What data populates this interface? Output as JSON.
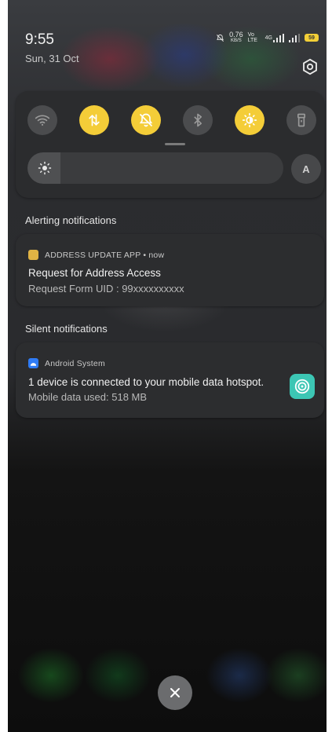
{
  "status_bar": {
    "time": "9:55",
    "date": "Sun, 31 Oct",
    "network_speed": "0.76",
    "network_speed_unit": "KB/S",
    "volte": "Vo LTE",
    "signal_label": "4G",
    "battery_level": "59"
  },
  "quick_settings": {
    "tiles": [
      {
        "name": "wifi",
        "state": "off",
        "icon": "wifi-icon"
      },
      {
        "name": "mobile-data",
        "state": "on",
        "icon": "data-arrows-icon"
      },
      {
        "name": "silent",
        "state": "on",
        "icon": "bell-off-icon"
      },
      {
        "name": "bluetooth",
        "state": "off",
        "icon": "bluetooth-icon"
      },
      {
        "name": "dark-mode",
        "state": "on",
        "icon": "sun-moon-icon"
      },
      {
        "name": "flashlight",
        "state": "off",
        "icon": "flashlight-icon"
      }
    ],
    "brightness_level": 0.13,
    "auto_brightness_label": "A"
  },
  "sections": {
    "alerting_title": "Alerting notifications",
    "silent_title": "Silent notifications"
  },
  "notifications": {
    "address": {
      "app_name": "ADDRESS UPDATE APP",
      "time": "now",
      "title": "Request for Address Access",
      "text": "Request Form UID : 99xxxxxxxxxx"
    },
    "hotspot": {
      "app_name": "Android System",
      "title": "1 device is connected to your mobile data hotspot.",
      "text": "Mobile data used: 518 MB"
    }
  },
  "colors": {
    "toggle_on": "#f4cd38",
    "toggle_off": "#4b4c4e",
    "hotspot_teal": "#3cc6b4",
    "android_blue": "#2f7cf6"
  }
}
